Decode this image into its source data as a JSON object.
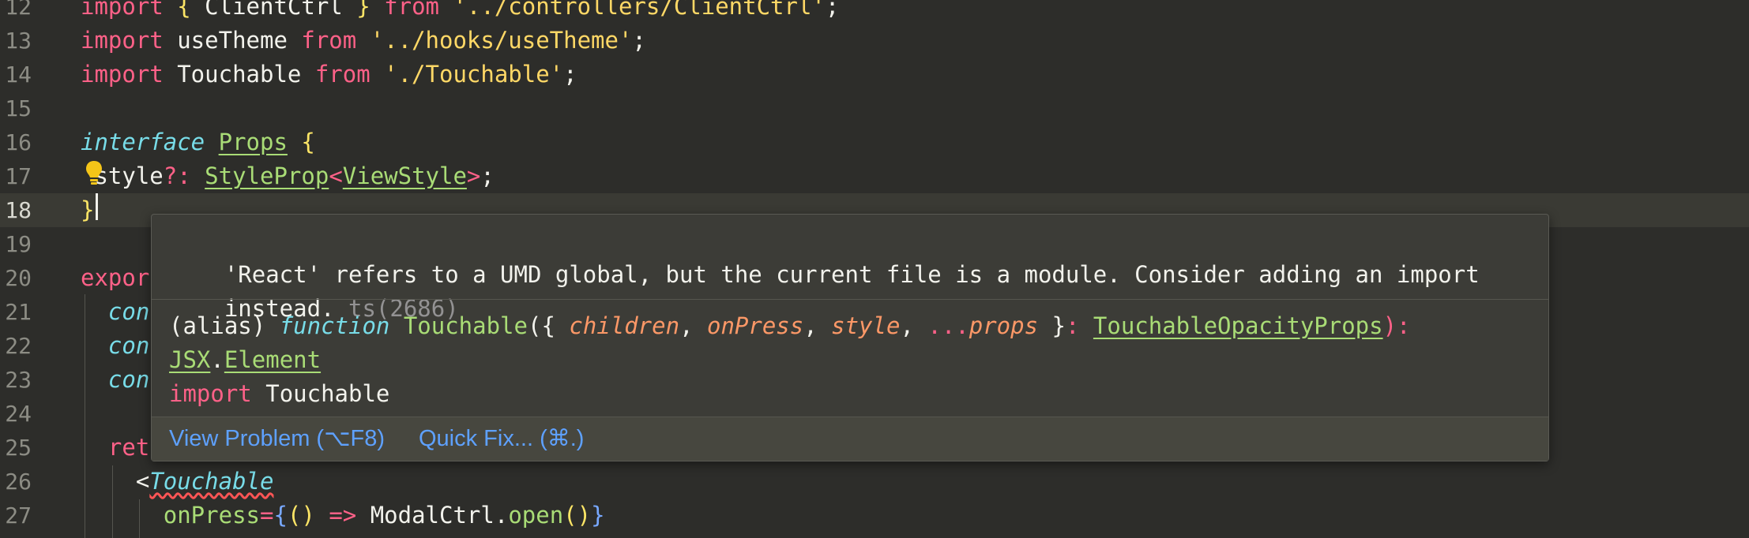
{
  "editor": {
    "lines": [
      {
        "num": "12",
        "tokens": [
          {
            "t": "import",
            "c": "kw"
          },
          {
            "t": " "
          },
          {
            "t": "{",
            "c": "brace"
          },
          {
            "t": " ClientCtrl ",
            "c": "plain"
          },
          {
            "t": "}",
            "c": "brace"
          },
          {
            "t": " "
          },
          {
            "t": "from",
            "c": "kw"
          },
          {
            "t": " "
          },
          {
            "t": "'../controllers/ClientCtrl'",
            "c": "str"
          },
          {
            "t": ";",
            "c": "plain"
          }
        ]
      },
      {
        "num": "13",
        "tokens": [
          {
            "t": "import",
            "c": "kw"
          },
          {
            "t": " useTheme ",
            "c": "plain"
          },
          {
            "t": "from",
            "c": "kw"
          },
          {
            "t": " "
          },
          {
            "t": "'../hooks/useTheme'",
            "c": "str"
          },
          {
            "t": ";",
            "c": "plain"
          }
        ]
      },
      {
        "num": "14",
        "tokens": [
          {
            "t": "import",
            "c": "kw"
          },
          {
            "t": " Touchable ",
            "c": "plain"
          },
          {
            "t": "from",
            "c": "kw"
          },
          {
            "t": " "
          },
          {
            "t": "'./Touchable'",
            "c": "str"
          },
          {
            "t": ";",
            "c": "plain"
          }
        ]
      },
      {
        "num": "15",
        "tokens": []
      },
      {
        "num": "16",
        "tokens": [
          {
            "t": "interface",
            "c": "it"
          },
          {
            "t": " "
          },
          {
            "t": "Props",
            "c": "type"
          },
          {
            "t": " "
          },
          {
            "t": "{",
            "c": "brace"
          }
        ]
      },
      {
        "num": "17",
        "tokens": [
          {
            "t": " "
          },
          {
            "t": "style",
            "c": "plain"
          },
          {
            "t": "?:",
            "c": "op"
          },
          {
            "t": " "
          },
          {
            "t": "StyleProp",
            "c": "type"
          },
          {
            "t": "<",
            "c": "op"
          },
          {
            "t": "ViewStyle",
            "c": "type"
          },
          {
            "t": ">",
            "c": "op"
          },
          {
            "t": ";",
            "c": "plain"
          }
        ]
      },
      {
        "num": "18",
        "tokens": [
          {
            "t": "}",
            "c": "brace"
          }
        ]
      },
      {
        "num": "19",
        "tokens": []
      },
      {
        "num": "20",
        "tokens": [
          {
            "t": "expor",
            "c": "kw"
          }
        ]
      },
      {
        "num": "21",
        "tokens": [
          {
            "t": "  "
          },
          {
            "t": "con",
            "c": "it"
          }
        ]
      },
      {
        "num": "22",
        "tokens": [
          {
            "t": "  "
          },
          {
            "t": "con",
            "c": "it"
          }
        ]
      },
      {
        "num": "23",
        "tokens": [
          {
            "t": "  "
          },
          {
            "t": "con",
            "c": "it"
          }
        ]
      },
      {
        "num": "24",
        "tokens": []
      },
      {
        "num": "25",
        "tokens": [
          {
            "t": "  "
          },
          {
            "t": "ret",
            "c": "kw"
          }
        ]
      },
      {
        "num": "26",
        "tokens": [
          {
            "t": "    "
          },
          {
            "t": "<",
            "c": "plain"
          },
          {
            "t": "Touchable",
            "c": "tagname"
          }
        ]
      },
      {
        "num": "27",
        "tokens": [
          {
            "t": "      "
          },
          {
            "t": "onPress",
            "c": "fn"
          },
          {
            "t": "=",
            "c": "op"
          },
          {
            "t": "{",
            "c": "blue"
          },
          {
            "t": "() ",
            "c": "brace"
          },
          {
            "t": "=>",
            "c": "op"
          },
          {
            "t": " ModalCtrl",
            "c": "plain"
          },
          {
            "t": ".",
            "c": "plain"
          },
          {
            "t": "open",
            "c": "fn"
          },
          {
            "t": "()",
            "c": "brace"
          },
          {
            "t": "}",
            "c": "blue"
          }
        ]
      }
    ],
    "current_line": "18"
  },
  "hover": {
    "problem_line1": "'React' refers to a UMD global, but the current file is a module. Consider adding an import",
    "problem_line2": "instead.",
    "problem_code": "ts(2686)",
    "sig": {
      "alias": "(alias)",
      "function_kw": "function",
      "name": "Touchable",
      "open": "({ ",
      "p1": "children",
      "p2": "onPress",
      "p3": "style",
      "spread": "...",
      "p4": "props",
      "close": " }",
      "colon": ":",
      "type": "TouchableOpacityProps",
      "paren_close": "):",
      "ret_ns": "JSX",
      "dot": ".",
      "ret_type": "Element",
      "import_kw": "import",
      "import_name": "Touchable"
    },
    "actions": {
      "view_problem": "View Problem (⌥F8)",
      "quick_fix": "Quick Fix... (⌘.)"
    }
  },
  "colors": {
    "background": "#2d2d2a",
    "keyword": "#ff6188",
    "string": "#ffd866",
    "type": "#a9dc76",
    "italic_keyword": "#78dce8",
    "link": "#5ea1ff"
  }
}
